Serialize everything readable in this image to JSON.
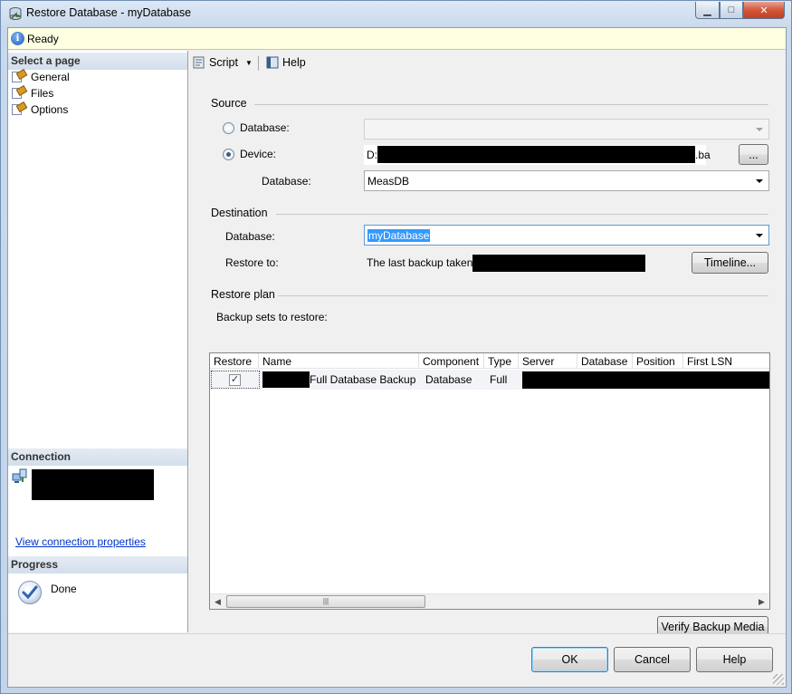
{
  "window": {
    "title": "Restore Database - myDatabase"
  },
  "status": {
    "text": "Ready"
  },
  "left": {
    "select_page_header": "Select a page",
    "pages": [
      {
        "label": "General"
      },
      {
        "label": "Files"
      },
      {
        "label": "Options"
      }
    ],
    "connection_header": "Connection",
    "view_connection_link": "View connection properties",
    "progress_header": "Progress",
    "progress_status": "Done"
  },
  "toolbar": {
    "script_label": "Script",
    "help_label": "Help"
  },
  "source": {
    "group_label": "Source",
    "database_radio_label": "Database:",
    "device_radio_label": "Device:",
    "device_path_prefix": "D:\\",
    "device_path_suffix": ".ba",
    "browse_label": "...",
    "database_label": "Database:",
    "database_value": "MeasDB",
    "selected_source": "device"
  },
  "destination": {
    "group_label": "Destination",
    "database_label": "Database:",
    "database_value": "myDatabase",
    "restore_to_label": "Restore to:",
    "restore_to_value": "The last backup taken",
    "timeline_label": "Timeline..."
  },
  "restore_plan": {
    "group_label": "Restore plan",
    "backup_sets_label": "Backup sets to restore:",
    "columns": [
      "Restore",
      "Name",
      "Component",
      "Type",
      "Server",
      "Database",
      "Position",
      "First LSN"
    ],
    "rows": [
      {
        "restore": true,
        "name": "Full Database Backup",
        "component": "Database",
        "type": "Full"
      }
    ],
    "verify_label": "Verify Backup Media"
  },
  "buttons": {
    "ok": "OK",
    "cancel": "Cancel",
    "help": "Help"
  },
  "colors": {
    "selection": "#3399ff",
    "link": "#0033cc",
    "status_bg": "#ffffe1"
  }
}
